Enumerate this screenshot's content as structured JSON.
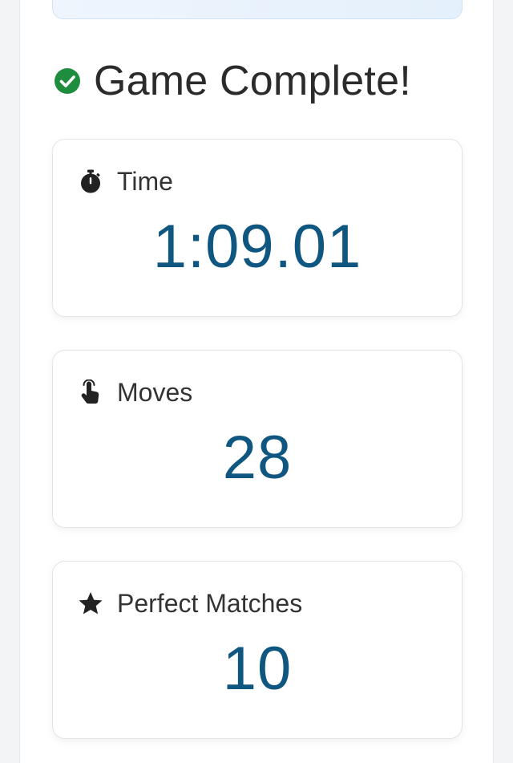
{
  "heading": {
    "title": "Game Complete!",
    "icon": "check-circle-icon",
    "icon_color": "#1e8e3e"
  },
  "stats": [
    {
      "label": "Time",
      "value": "1:09.01",
      "icon": "stopwatch-icon"
    },
    {
      "label": "Moves",
      "value": "28",
      "icon": "tap-hand-icon"
    },
    {
      "label": "Perfect Matches",
      "value": "10",
      "icon": "star-icon"
    }
  ],
  "colors": {
    "value_text": "#0f5680",
    "label_text": "#333333",
    "page_background": "#f3f4f6",
    "card_background": "#ffffff"
  }
}
